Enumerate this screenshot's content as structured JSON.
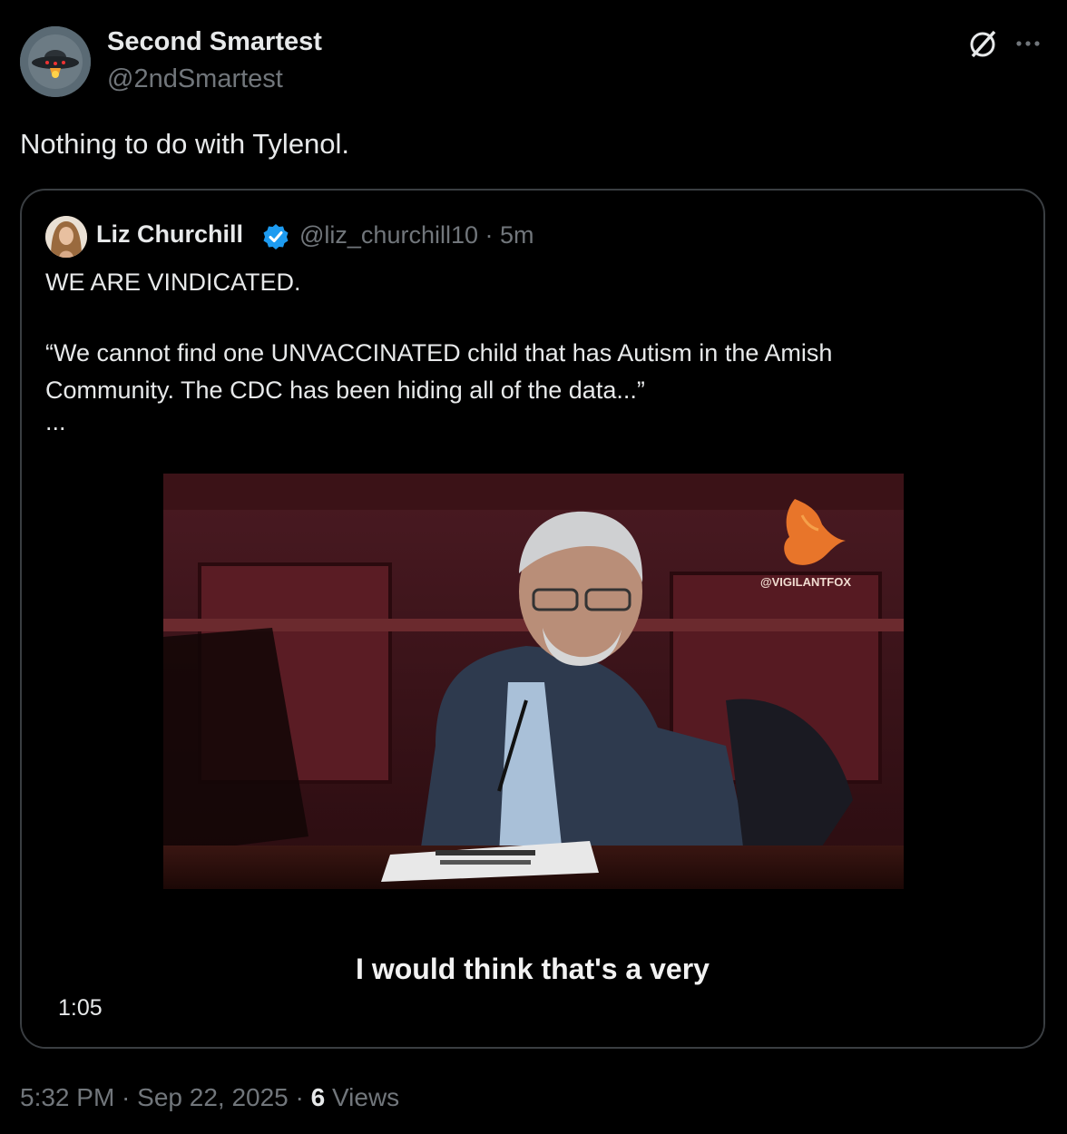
{
  "post": {
    "author_name": "Second Smartest",
    "author_handle": "@2ndSmartest",
    "text": "Nothing to do with Tylenol.",
    "timestamp": "5:32 PM · Sep 22, 2025 · ",
    "views_count": "6",
    "views_label": " Views"
  },
  "quoted": {
    "author_name": "Liz Churchill",
    "meta": "@liz_churchill10 · 5m",
    "line1": "WE ARE VINDICATED.",
    "line2": "“We cannot find one UNVACCINATED child that has Autism in the Amish",
    "line3": "Community. The CDC has been hiding all of the data...”",
    "ellipsis": "...",
    "video": {
      "watermark": "@VIGILANTFOX",
      "caption": "I would think that's a very",
      "duration": "1:05"
    }
  },
  "icons": {
    "grok": "grok-icon",
    "more": "more-icon",
    "verified": "verified-badge-icon"
  },
  "colors": {
    "background": "#000000",
    "text": "#e7e9ea",
    "muted": "#71767b",
    "verified": "#1d9bf0",
    "border": "#3a3e42"
  }
}
